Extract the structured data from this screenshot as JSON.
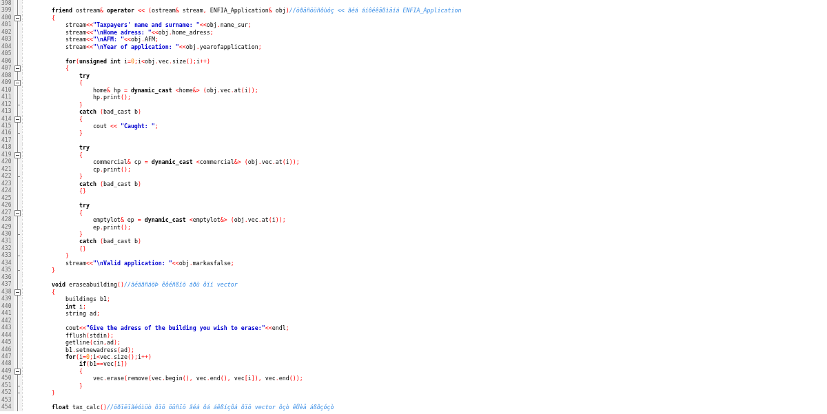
{
  "editor": {
    "lines": [
      {
        "number": "398",
        "fold_start": false,
        "fold_end": false
      },
      {
        "number": "399",
        "fold_start": false,
        "fold_end": false,
        "tokens": [
          {
            "kind": "kw",
            "text": "        friend"
          },
          {
            "kind": "tx",
            "text": " ostream& "
          },
          {
            "kind": "kw",
            "text": "operator"
          },
          {
            "kind": "tx",
            "text": " << (ostream& stream, ENFIA_Application& obj)"
          },
          {
            "kind": "cm",
            "text": "//õðåñöüñôùóç << ãéá áíôéêåßìåíá ENFIA_Application"
          }
        ]
      },
      {
        "number": "400",
        "fold_start": true,
        "fold_end": false,
        "tokens": [
          {
            "kind": "tx",
            "text": "        {"
          }
        ]
      },
      {
        "number": "401",
        "fold_start": false,
        "fold_end": false,
        "tokens": [
          {
            "kind": "tx",
            "text": "            stream<<"
          },
          {
            "kind": "str",
            "text": "\"Taxpayers' name and surname: \""
          },
          {
            "kind": "tx",
            "text": "<<obj.name_sur;"
          }
        ]
      },
      {
        "number": "402",
        "fold_start": false,
        "fold_end": false,
        "tokens": [
          {
            "kind": "tx",
            "text": "            stream<<"
          },
          {
            "kind": "str",
            "text": "\"\\nHome adress: \""
          },
          {
            "kind": "tx",
            "text": "<<obj.home_adress;"
          }
        ]
      },
      {
        "number": "403",
        "fold_start": false,
        "fold_end": false,
        "tokens": [
          {
            "kind": "tx",
            "text": "            stream<<"
          },
          {
            "kind": "str",
            "text": "\"\\nAFM: \""
          },
          {
            "kind": "tx",
            "text": "<<obj.AFM;"
          }
        ]
      },
      {
        "number": "404",
        "fold_start": false,
        "fold_end": false,
        "tokens": [
          {
            "kind": "tx",
            "text": "            stream<<"
          },
          {
            "kind": "str",
            "text": "\"\\nYear of application: \""
          },
          {
            "kind": "tx",
            "text": "<<obj.yearofapplication;"
          }
        ]
      },
      {
        "number": "405",
        "fold_start": false,
        "fold_end": false
      },
      {
        "number": "406",
        "fold_start": false,
        "fold_end": false,
        "tokens": [
          {
            "kind": "kw",
            "text": "            for"
          },
          {
            "kind": "tx",
            "text": "("
          },
          {
            "kind": "kw",
            "text": "unsigned int"
          },
          {
            "kind": "tx",
            "text": " i="
          },
          {
            "kind": "num",
            "text": "0"
          },
          {
            "kind": "tx",
            "text": ";i<obj.vec.size();i++)"
          }
        ]
      },
      {
        "number": "407",
        "fold_start": true,
        "fold_end": false,
        "tokens": [
          {
            "kind": "tx",
            "text": "            {"
          }
        ]
      },
      {
        "number": "408",
        "fold_start": false,
        "fold_end": false,
        "tokens": [
          {
            "kind": "kw",
            "text": "                try"
          }
        ]
      },
      {
        "number": "409",
        "fold_start": true,
        "fold_end": false,
        "tokens": [
          {
            "kind": "tx",
            "text": "                {"
          }
        ]
      },
      {
        "number": "410",
        "fold_start": false,
        "fold_end": false,
        "tokens": [
          {
            "kind": "tx",
            "text": "                    home& hp = "
          },
          {
            "kind": "kw",
            "text": "dynamic_cast"
          },
          {
            "kind": "tx",
            "text": " <home&> (obj.vec.at(i));"
          }
        ]
      },
      {
        "number": "411",
        "fold_start": false,
        "fold_end": false,
        "tokens": [
          {
            "kind": "tx",
            "text": "                    hp.print();"
          }
        ]
      },
      {
        "number": "412",
        "fold_start": false,
        "fold_end": true,
        "tokens": [
          {
            "kind": "tx",
            "text": "                }"
          }
        ]
      },
      {
        "number": "413",
        "fold_start": false,
        "fold_end": false,
        "tokens": [
          {
            "kind": "kw",
            "text": "                catch"
          },
          {
            "kind": "tx",
            "text": " (bad_cast b)"
          }
        ]
      },
      {
        "number": "414",
        "fold_start": true,
        "fold_end": false,
        "tokens": [
          {
            "kind": "tx",
            "text": "                {"
          }
        ]
      },
      {
        "number": "415",
        "fold_start": false,
        "fold_end": false,
        "tokens": [
          {
            "kind": "tx",
            "text": "                    cout << "
          },
          {
            "kind": "str",
            "text": "\"Caught: \""
          },
          {
            "kind": "tx",
            "text": ";"
          }
        ]
      },
      {
        "number": "416",
        "fold_start": false,
        "fold_end": true,
        "tokens": [
          {
            "kind": "tx",
            "text": "                }"
          }
        ]
      },
      {
        "number": "417",
        "fold_start": false,
        "fold_end": false
      },
      {
        "number": "418",
        "fold_start": false,
        "fold_end": false,
        "tokens": [
          {
            "kind": "kw",
            "text": "                try"
          }
        ]
      },
      {
        "number": "419",
        "fold_start": true,
        "fold_end": false,
        "tokens": [
          {
            "kind": "tx",
            "text": "                {"
          }
        ]
      },
      {
        "number": "420",
        "fold_start": false,
        "fold_end": false,
        "tokens": [
          {
            "kind": "tx",
            "text": "                    commercial& cp = "
          },
          {
            "kind": "kw",
            "text": "dynamic_cast"
          },
          {
            "kind": "tx",
            "text": " <commercial&> (obj.vec.at(i));"
          }
        ]
      },
      {
        "number": "421",
        "fold_start": false,
        "fold_end": false,
        "tokens": [
          {
            "kind": "tx",
            "text": "                    cp.print();"
          }
        ]
      },
      {
        "number": "422",
        "fold_start": false,
        "fold_end": true,
        "tokens": [
          {
            "kind": "tx",
            "text": "                }"
          }
        ]
      },
      {
        "number": "423",
        "fold_start": false,
        "fold_end": false,
        "tokens": [
          {
            "kind": "kw",
            "text": "                catch"
          },
          {
            "kind": "tx",
            "text": " (bad_cast b)"
          }
        ]
      },
      {
        "number": "424",
        "fold_start": false,
        "fold_end": false,
        "tokens": [
          {
            "kind": "tx",
            "text": "                {}"
          }
        ]
      },
      {
        "number": "425",
        "fold_start": false,
        "fold_end": false
      },
      {
        "number": "426",
        "fold_start": false,
        "fold_end": false,
        "tokens": [
          {
            "kind": "kw",
            "text": "                try"
          }
        ]
      },
      {
        "number": "427",
        "fold_start": true,
        "fold_end": false,
        "tokens": [
          {
            "kind": "tx",
            "text": "                {"
          }
        ]
      },
      {
        "number": "428",
        "fold_start": false,
        "fold_end": false,
        "tokens": [
          {
            "kind": "tx",
            "text": "                    emptylot& ep = "
          },
          {
            "kind": "kw",
            "text": "dynamic_cast"
          },
          {
            "kind": "tx",
            "text": " <emptylot&> (obj.vec.at(i));"
          }
        ]
      },
      {
        "number": "429",
        "fold_start": false,
        "fold_end": false,
        "tokens": [
          {
            "kind": "tx",
            "text": "                    ep.print();"
          }
        ]
      },
      {
        "number": "430",
        "fold_start": false,
        "fold_end": true,
        "tokens": [
          {
            "kind": "tx",
            "text": "                }"
          }
        ]
      },
      {
        "number": "431",
        "fold_start": false,
        "fold_end": false,
        "tokens": [
          {
            "kind": "kw",
            "text": "                catch"
          },
          {
            "kind": "tx",
            "text": " (bad_cast b)"
          }
        ]
      },
      {
        "number": "432",
        "fold_start": false,
        "fold_end": false,
        "tokens": [
          {
            "kind": "tx",
            "text": "                {}"
          }
        ]
      },
      {
        "number": "433",
        "fold_start": false,
        "fold_end": true,
        "tokens": [
          {
            "kind": "tx",
            "text": "            }"
          }
        ]
      },
      {
        "number": "434",
        "fold_start": false,
        "fold_end": false,
        "tokens": [
          {
            "kind": "tx",
            "text": "            stream<<"
          },
          {
            "kind": "str",
            "text": "\"\\nValid application: \""
          },
          {
            "kind": "tx",
            "text": "<<obj.markasfalse;"
          }
        ]
      },
      {
        "number": "435",
        "fold_start": false,
        "fold_end": true,
        "tokens": [
          {
            "kind": "tx",
            "text": "        }"
          }
        ]
      },
      {
        "number": "436",
        "fold_start": false,
        "fold_end": false
      },
      {
        "number": "437",
        "fold_start": false,
        "fold_end": false,
        "tokens": [
          {
            "kind": "kw",
            "text": "        void"
          },
          {
            "kind": "tx",
            "text": " eraseabuilding()"
          },
          {
            "kind": "cm",
            "text": "//äéáãñáöÞ êôéñßïõ áðü ôïí vector"
          }
        ]
      },
      {
        "number": "438",
        "fold_start": true,
        "fold_end": false,
        "tokens": [
          {
            "kind": "tx",
            "text": "        {"
          }
        ]
      },
      {
        "number": "439",
        "fold_start": false,
        "fold_end": false,
        "tokens": [
          {
            "kind": "tx",
            "text": "            buildings b1;"
          }
        ]
      },
      {
        "number": "440",
        "fold_start": false,
        "fold_end": false,
        "tokens": [
          {
            "kind": "kw",
            "text": "            int"
          },
          {
            "kind": "tx",
            "text": " i;"
          }
        ]
      },
      {
        "number": "441",
        "fold_start": false,
        "fold_end": false,
        "tokens": [
          {
            "kind": "tx",
            "text": "            string ad;"
          }
        ]
      },
      {
        "number": "442",
        "fold_start": false,
        "fold_end": false
      },
      {
        "number": "443",
        "fold_start": false,
        "fold_end": false,
        "tokens": [
          {
            "kind": "tx",
            "text": "            cout<<"
          },
          {
            "kind": "str",
            "text": "\"Give the adress of the building you wish to erase:\""
          },
          {
            "kind": "tx",
            "text": "<<endl;"
          }
        ]
      },
      {
        "number": "444",
        "fold_start": false,
        "fold_end": false,
        "tokens": [
          {
            "kind": "tx",
            "text": "            fflush(stdin);"
          }
        ]
      },
      {
        "number": "445",
        "fold_start": false,
        "fold_end": false,
        "tokens": [
          {
            "kind": "tx",
            "text": "            getline(cin,ad);"
          }
        ]
      },
      {
        "number": "446",
        "fold_start": false,
        "fold_end": false,
        "tokens": [
          {
            "kind": "tx",
            "text": "            b1.setnewadress(ad);"
          }
        ]
      },
      {
        "number": "447",
        "fold_start": false,
        "fold_end": false,
        "tokens": [
          {
            "kind": "kw",
            "text": "            for"
          },
          {
            "kind": "tx",
            "text": "(i="
          },
          {
            "kind": "num",
            "text": "0"
          },
          {
            "kind": "tx",
            "text": ";i<vec.size();i++)"
          }
        ]
      },
      {
        "number": "448",
        "fold_start": false,
        "fold_end": false,
        "tokens": [
          {
            "kind": "kw",
            "text": "                if"
          },
          {
            "kind": "tx",
            "text": "(b1==vec[i])"
          }
        ]
      },
      {
        "number": "449",
        "fold_start": true,
        "fold_end": false,
        "tokens": [
          {
            "kind": "tx",
            "text": "                {"
          }
        ]
      },
      {
        "number": "450",
        "fold_start": false,
        "fold_end": false,
        "tokens": [
          {
            "kind": "tx",
            "text": "                    vec.erase(remove(vec.begin(), vec.end(), vec[i]), vec.end());"
          }
        ]
      },
      {
        "number": "451",
        "fold_start": false,
        "fold_end": true,
        "tokens": [
          {
            "kind": "tx",
            "text": "                }"
          }
        ]
      },
      {
        "number": "452",
        "fold_start": false,
        "fold_end": true,
        "tokens": [
          {
            "kind": "tx",
            "text": "        }"
          }
        ]
      },
      {
        "number": "453",
        "fold_start": false,
        "fold_end": false
      },
      {
        "number": "454",
        "fold_start": false,
        "fold_end": false,
        "tokens": [
          {
            "kind": "kw",
            "text": "        float"
          },
          {
            "kind": "tx",
            "text": " tax_calc()"
          },
          {
            "kind": "cm",
            "text": "//õðïëïãéóìüò ôïõ öüñïõ ãéá ôá áêßíçôá ôïõ vector ôçò êÜèå áßôçóçò"
          }
        ]
      }
    ]
  }
}
